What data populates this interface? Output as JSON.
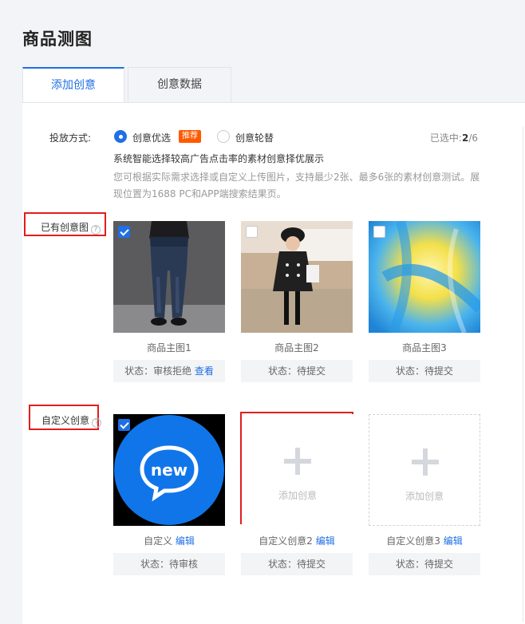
{
  "page_title": "商品测图",
  "tabs": [
    {
      "label": "添加创意",
      "active": true
    },
    {
      "label": "创意数据",
      "active": false
    }
  ],
  "mode": {
    "label": "投放方式:",
    "option_optimize": "创意优选",
    "badge": "推荐",
    "option_rotate": "创意轮替",
    "selected_prefix": "已选中:",
    "selected_count": "2",
    "selected_total": "/6",
    "desc_main": "系统智能选择较高广告点击率的素材创意择优展示",
    "desc_sub": "您可根据实际需求选择或自定义上传图片，支持最少2张、最多6张的素材创意测试。展现位置为1688 PC和APP端搜索结果页。"
  },
  "existing": {
    "label": "已有创意图",
    "help": "?",
    "items": [
      {
        "caption": "商品主图1",
        "status": "状态：审核拒绝",
        "link": "查看",
        "checked": true
      },
      {
        "caption": "商品主图2",
        "status": "状态：待提交",
        "checked": false
      },
      {
        "caption": "商品主图3",
        "status": "状态：待提交",
        "checked": false
      }
    ]
  },
  "custom": {
    "label": "自定义创意",
    "help": "?",
    "items": [
      {
        "caption": "自定义",
        "edit": "编辑",
        "status": "状态：待审核",
        "checked": true,
        "logo_text": "new"
      },
      {
        "caption": "自定义创意2",
        "edit": "编辑",
        "status": "状态：待提交",
        "add_text": "添加创意"
      },
      {
        "caption": "自定义创意3",
        "edit": "编辑",
        "status": "状态：待提交",
        "add_text": "添加创意"
      }
    ]
  },
  "colors": {
    "accent": "#1f6fe5",
    "highlight": "#e01e1e",
    "badge": "#ff5a00"
  }
}
